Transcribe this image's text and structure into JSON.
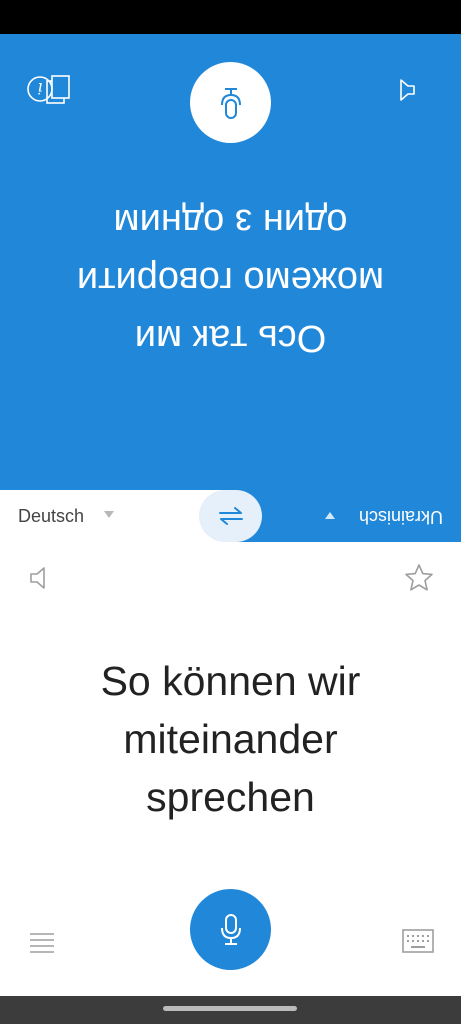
{
  "partner": {
    "text_lines": [
      "Ось так ми",
      "можемо говорити",
      "один з одним"
    ]
  },
  "languages": {
    "source": "Deutsch",
    "target": "Ukrainisch"
  },
  "user": {
    "text_lines": [
      "So können wir",
      "miteinander",
      "sprechen"
    ]
  },
  "icons": {
    "info": "info-icon",
    "mic": "microphone-icon",
    "copy": "copy-icon",
    "speaker": "speaker-icon",
    "swap": "swap-arrows-icon",
    "star": "star-icon",
    "menu": "menu-icon",
    "keyboard": "keyboard-icon"
  },
  "colors": {
    "accent": "#2187d9",
    "swap_bg": "#e6f0fa",
    "text_dark": "#222222",
    "icon_gray": "#9e9e9e"
  }
}
